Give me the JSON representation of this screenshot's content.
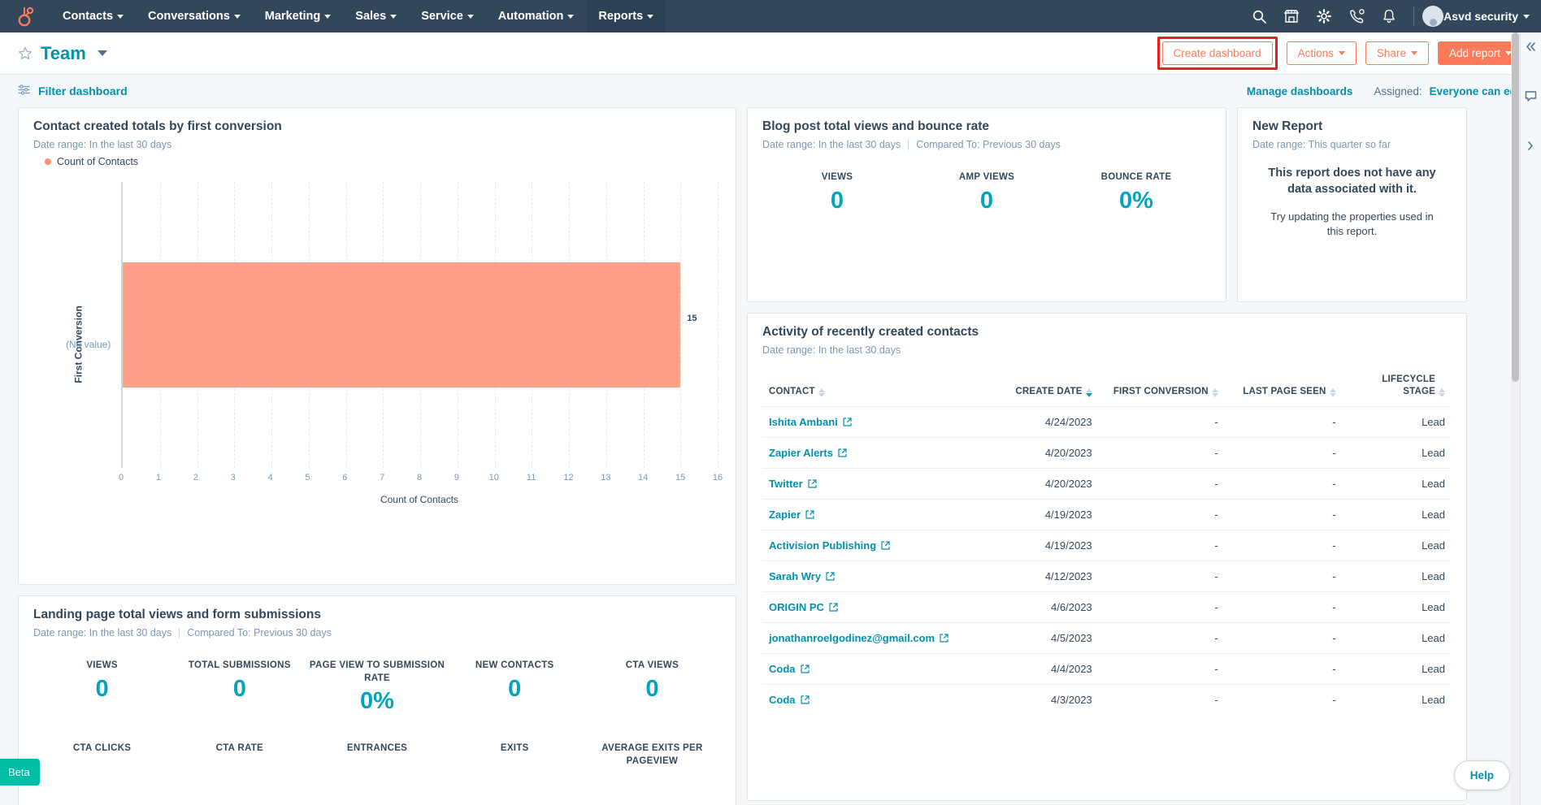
{
  "topnav": {
    "logo_name": "hubspot-logo",
    "menu": [
      {
        "label": "Contacts"
      },
      {
        "label": "Conversations"
      },
      {
        "label": "Marketing"
      },
      {
        "label": "Sales"
      },
      {
        "label": "Service"
      },
      {
        "label": "Automation"
      },
      {
        "label": "Reports"
      }
    ],
    "active_menu": "Reports",
    "icons": [
      "search-icon",
      "marketplace-icon",
      "gear-icon",
      "phone-icon",
      "bell-icon"
    ],
    "user": "Asvd security"
  },
  "header": {
    "title": "Team",
    "create_dashboard": "Create dashboard",
    "actions": "Actions",
    "share": "Share",
    "add_report": "Add report",
    "highlight_color": "#e8201c"
  },
  "filterbar": {
    "filter_dashboard": "Filter dashboard",
    "manage_dashboards": "Manage dashboards",
    "assigned_label": "Assigned:",
    "assigned_value": "Everyone can edit"
  },
  "chart_card": {
    "title": "Contact created totals by first conversion",
    "date_range": "Date range: In the last 30 days",
    "legend": "Count of Contacts"
  },
  "chart_data": {
    "type": "bar",
    "orientation": "horizontal",
    "title": "Contact created totals by first conversion",
    "categories": [
      "(No value)"
    ],
    "values": [
      15
    ],
    "series": [
      {
        "name": "Count of Contacts",
        "values": [
          15
        ],
        "color": "#ffa18a"
      }
    ],
    "xlabel": "Count of Contacts",
    "ylabel": "First Conversion",
    "xlim": [
      0,
      16
    ],
    "xticks": [
      0,
      1,
      2,
      3,
      4,
      5,
      6,
      7,
      8,
      9,
      10,
      11,
      12,
      13,
      14,
      15,
      16
    ],
    "grid": true,
    "legend_position": "top-left",
    "data_labels": [
      "15"
    ]
  },
  "blog_card": {
    "title": "Blog post total views and bounce rate",
    "date_range": "Date range: In the last 30 days",
    "compared_to": "Compared To: Previous 30 days",
    "metrics": [
      {
        "label": "VIEWS",
        "value": "0"
      },
      {
        "label": "AMP VIEWS",
        "value": "0"
      },
      {
        "label": "BOUNCE RATE",
        "value": "0%"
      }
    ]
  },
  "new_report_card": {
    "title": "New Report",
    "date_range": "Date range: This quarter so far",
    "empty_head": "This report does not have any data associated with it.",
    "empty_sub": "Try updating the properties used in this report."
  },
  "activity_card": {
    "title": "Activity of recently created contacts",
    "date_range": "Date range: In the last 30 days",
    "columns": [
      {
        "label": "CONTACT",
        "sorted": false
      },
      {
        "label": "CREATE DATE",
        "sorted": true,
        "direction": "desc"
      },
      {
        "label": "FIRST CONVERSION",
        "sorted": false
      },
      {
        "label": "LAST PAGE SEEN",
        "sorted": false
      },
      {
        "label": "LIFECYCLE STAGE",
        "sorted": false
      }
    ],
    "rows": [
      {
        "contact": "Ishita Ambani",
        "create_date": "4/24/2023",
        "first_conversion": "-",
        "last_page_seen": "-",
        "lifecycle_stage": "Lead"
      },
      {
        "contact": "Zapier Alerts",
        "create_date": "4/20/2023",
        "first_conversion": "-",
        "last_page_seen": "-",
        "lifecycle_stage": "Lead"
      },
      {
        "contact": "Twitter",
        "create_date": "4/20/2023",
        "first_conversion": "-",
        "last_page_seen": "-",
        "lifecycle_stage": "Lead"
      },
      {
        "contact": "Zapier",
        "create_date": "4/19/2023",
        "first_conversion": "-",
        "last_page_seen": "-",
        "lifecycle_stage": "Lead"
      },
      {
        "contact": "Activision Publishing",
        "create_date": "4/19/2023",
        "first_conversion": "-",
        "last_page_seen": "-",
        "lifecycle_stage": "Lead"
      },
      {
        "contact": "Sarah Wry",
        "create_date": "4/12/2023",
        "first_conversion": "-",
        "last_page_seen": "-",
        "lifecycle_stage": "Lead"
      },
      {
        "contact": "ORIGIN PC",
        "create_date": "4/6/2023",
        "first_conversion": "-",
        "last_page_seen": "-",
        "lifecycle_stage": "Lead"
      },
      {
        "contact": "jonathanroelgodinez@gmail.com",
        "create_date": "4/5/2023",
        "first_conversion": "-",
        "last_page_seen": "-",
        "lifecycle_stage": "Lead"
      },
      {
        "contact": "Coda",
        "create_date": "4/4/2023",
        "first_conversion": "-",
        "last_page_seen": "-",
        "lifecycle_stage": "Lead"
      },
      {
        "contact": "Coda",
        "create_date": "4/3/2023",
        "first_conversion": "-",
        "last_page_seen": "-",
        "lifecycle_stage": "Lead"
      }
    ]
  },
  "landing_card": {
    "title": "Landing page total views and form submissions",
    "date_range": "Date range: In the last 30 days",
    "compared_to": "Compared To: Previous 30 days",
    "metrics_row1": [
      {
        "label": "VIEWS",
        "value": "0"
      },
      {
        "label": "TOTAL SUBMISSIONS",
        "value": "0"
      },
      {
        "label": "PAGE VIEW TO SUBMISSION RATE",
        "value": "0%"
      },
      {
        "label": "NEW CONTACTS",
        "value": "0"
      },
      {
        "label": "CTA VIEWS",
        "value": "0"
      }
    ],
    "metrics_row2": [
      {
        "label": "CTA CLICKS"
      },
      {
        "label": "CTA RATE"
      },
      {
        "label": "ENTRANCES"
      },
      {
        "label": "EXITS"
      },
      {
        "label": "AVERAGE EXITS PER PAGEVIEW"
      }
    ]
  },
  "floating": {
    "beta": "Beta",
    "help": "Help"
  }
}
